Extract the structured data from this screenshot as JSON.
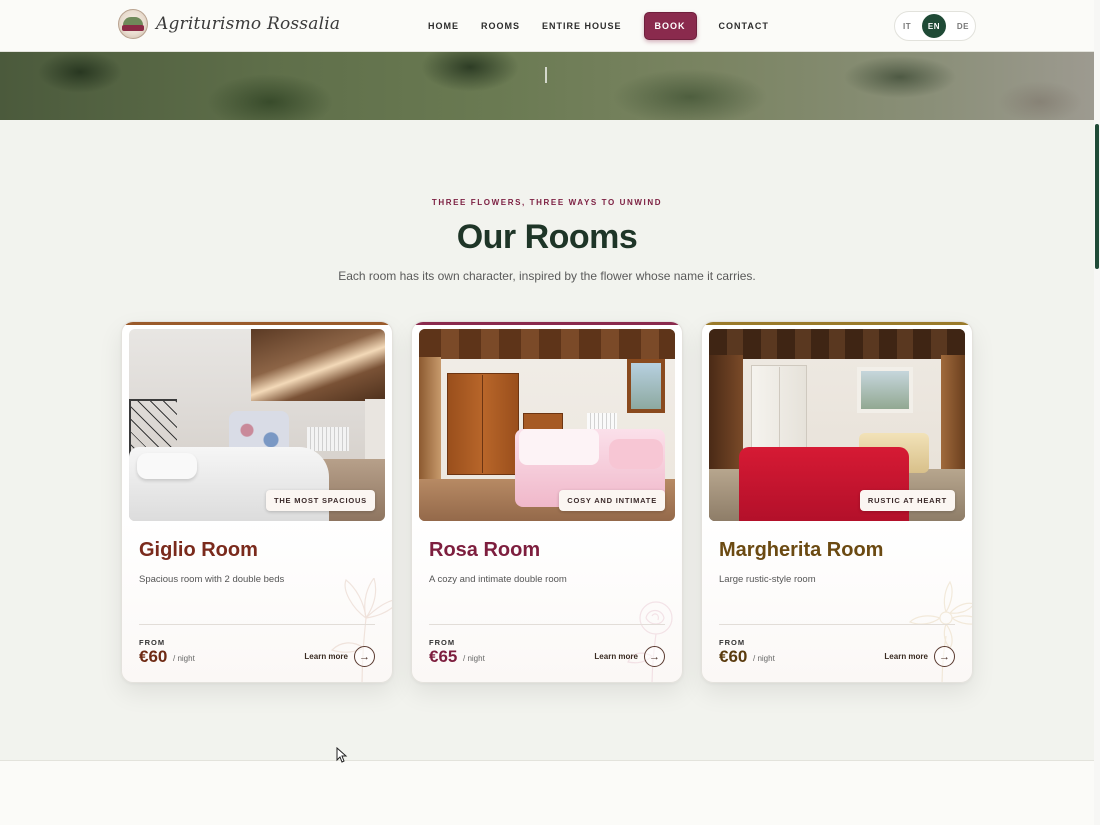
{
  "header": {
    "logo_text": "Agriturismo Rossalia",
    "nav": {
      "home": "HOME",
      "rooms": "ROOMS",
      "entire_house": "ENTIRE HOUSE",
      "book": "BOOK",
      "contact": "CONTACT"
    },
    "languages": {
      "it": "IT",
      "en": "EN",
      "de": "DE",
      "active": "EN"
    }
  },
  "section": {
    "eyebrow": "THREE FLOWERS, THREE WAYS TO UNWIND",
    "title": "Our Rooms",
    "subtitle": "Each room has its own character, inspired by the flower whose name it carries."
  },
  "rooms": [
    {
      "badge": "THE MOST SPACIOUS",
      "name": "Giglio Room",
      "description": "Spacious room with 2 double beds",
      "from_label": "FROM",
      "price": "€60",
      "per": "/ night",
      "cta": "Learn more",
      "accent": "#7a2a1c",
      "bar": "#9a5a2a"
    },
    {
      "badge": "COSY AND INTIMATE",
      "name": "Rosa Room",
      "description": "A cozy and intimate double room",
      "from_label": "FROM",
      "price": "€65",
      "per": "/ night",
      "cta": "Learn more",
      "accent": "#7d1e3e",
      "bar": "#8a2a4d"
    },
    {
      "badge": "RUSTIC AT HEART",
      "name": "Margherita Room",
      "description": "Large rustic-style room",
      "from_label": "FROM",
      "price": "€60",
      "per": "/ night",
      "cta": "Learn more",
      "accent": "#6b4a12",
      "bar": "#9a7a2a"
    }
  ],
  "colors": {
    "brand": "#8a2a4d",
    "dark_green": "#1f4a36",
    "background": "#f2f3ee"
  },
  "icons": {
    "arrow": "arrow-right-icon",
    "cursor": "mouse-pointer-icon"
  }
}
